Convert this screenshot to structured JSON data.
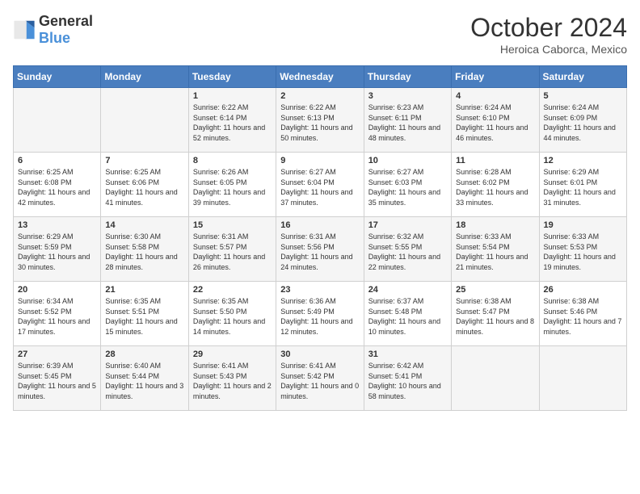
{
  "header": {
    "logo_general": "General",
    "logo_blue": "Blue",
    "month_title": "October 2024",
    "location": "Heroica Caborca, Mexico"
  },
  "weekdays": [
    "Sunday",
    "Monday",
    "Tuesday",
    "Wednesday",
    "Thursday",
    "Friday",
    "Saturday"
  ],
  "weeks": [
    [
      {
        "day": "",
        "info": ""
      },
      {
        "day": "",
        "info": ""
      },
      {
        "day": "1",
        "info": "Sunrise: 6:22 AM\nSunset: 6:14 PM\nDaylight: 11 hours and 52 minutes."
      },
      {
        "day": "2",
        "info": "Sunrise: 6:22 AM\nSunset: 6:13 PM\nDaylight: 11 hours and 50 minutes."
      },
      {
        "day": "3",
        "info": "Sunrise: 6:23 AM\nSunset: 6:11 PM\nDaylight: 11 hours and 48 minutes."
      },
      {
        "day": "4",
        "info": "Sunrise: 6:24 AM\nSunset: 6:10 PM\nDaylight: 11 hours and 46 minutes."
      },
      {
        "day": "5",
        "info": "Sunrise: 6:24 AM\nSunset: 6:09 PM\nDaylight: 11 hours and 44 minutes."
      }
    ],
    [
      {
        "day": "6",
        "info": "Sunrise: 6:25 AM\nSunset: 6:08 PM\nDaylight: 11 hours and 42 minutes."
      },
      {
        "day": "7",
        "info": "Sunrise: 6:25 AM\nSunset: 6:06 PM\nDaylight: 11 hours and 41 minutes."
      },
      {
        "day": "8",
        "info": "Sunrise: 6:26 AM\nSunset: 6:05 PM\nDaylight: 11 hours and 39 minutes."
      },
      {
        "day": "9",
        "info": "Sunrise: 6:27 AM\nSunset: 6:04 PM\nDaylight: 11 hours and 37 minutes."
      },
      {
        "day": "10",
        "info": "Sunrise: 6:27 AM\nSunset: 6:03 PM\nDaylight: 11 hours and 35 minutes."
      },
      {
        "day": "11",
        "info": "Sunrise: 6:28 AM\nSunset: 6:02 PM\nDaylight: 11 hours and 33 minutes."
      },
      {
        "day": "12",
        "info": "Sunrise: 6:29 AM\nSunset: 6:01 PM\nDaylight: 11 hours and 31 minutes."
      }
    ],
    [
      {
        "day": "13",
        "info": "Sunrise: 6:29 AM\nSunset: 5:59 PM\nDaylight: 11 hours and 30 minutes."
      },
      {
        "day": "14",
        "info": "Sunrise: 6:30 AM\nSunset: 5:58 PM\nDaylight: 11 hours and 28 minutes."
      },
      {
        "day": "15",
        "info": "Sunrise: 6:31 AM\nSunset: 5:57 PM\nDaylight: 11 hours and 26 minutes."
      },
      {
        "day": "16",
        "info": "Sunrise: 6:31 AM\nSunset: 5:56 PM\nDaylight: 11 hours and 24 minutes."
      },
      {
        "day": "17",
        "info": "Sunrise: 6:32 AM\nSunset: 5:55 PM\nDaylight: 11 hours and 22 minutes."
      },
      {
        "day": "18",
        "info": "Sunrise: 6:33 AM\nSunset: 5:54 PM\nDaylight: 11 hours and 21 minutes."
      },
      {
        "day": "19",
        "info": "Sunrise: 6:33 AM\nSunset: 5:53 PM\nDaylight: 11 hours and 19 minutes."
      }
    ],
    [
      {
        "day": "20",
        "info": "Sunrise: 6:34 AM\nSunset: 5:52 PM\nDaylight: 11 hours and 17 minutes."
      },
      {
        "day": "21",
        "info": "Sunrise: 6:35 AM\nSunset: 5:51 PM\nDaylight: 11 hours and 15 minutes."
      },
      {
        "day": "22",
        "info": "Sunrise: 6:35 AM\nSunset: 5:50 PM\nDaylight: 11 hours and 14 minutes."
      },
      {
        "day": "23",
        "info": "Sunrise: 6:36 AM\nSunset: 5:49 PM\nDaylight: 11 hours and 12 minutes."
      },
      {
        "day": "24",
        "info": "Sunrise: 6:37 AM\nSunset: 5:48 PM\nDaylight: 11 hours and 10 minutes."
      },
      {
        "day": "25",
        "info": "Sunrise: 6:38 AM\nSunset: 5:47 PM\nDaylight: 11 hours and 8 minutes."
      },
      {
        "day": "26",
        "info": "Sunrise: 6:38 AM\nSunset: 5:46 PM\nDaylight: 11 hours and 7 minutes."
      }
    ],
    [
      {
        "day": "27",
        "info": "Sunrise: 6:39 AM\nSunset: 5:45 PM\nDaylight: 11 hours and 5 minutes."
      },
      {
        "day": "28",
        "info": "Sunrise: 6:40 AM\nSunset: 5:44 PM\nDaylight: 11 hours and 3 minutes."
      },
      {
        "day": "29",
        "info": "Sunrise: 6:41 AM\nSunset: 5:43 PM\nDaylight: 11 hours and 2 minutes."
      },
      {
        "day": "30",
        "info": "Sunrise: 6:41 AM\nSunset: 5:42 PM\nDaylight: 11 hours and 0 minutes."
      },
      {
        "day": "31",
        "info": "Sunrise: 6:42 AM\nSunset: 5:41 PM\nDaylight: 10 hours and 58 minutes."
      },
      {
        "day": "",
        "info": ""
      },
      {
        "day": "",
        "info": ""
      }
    ]
  ]
}
